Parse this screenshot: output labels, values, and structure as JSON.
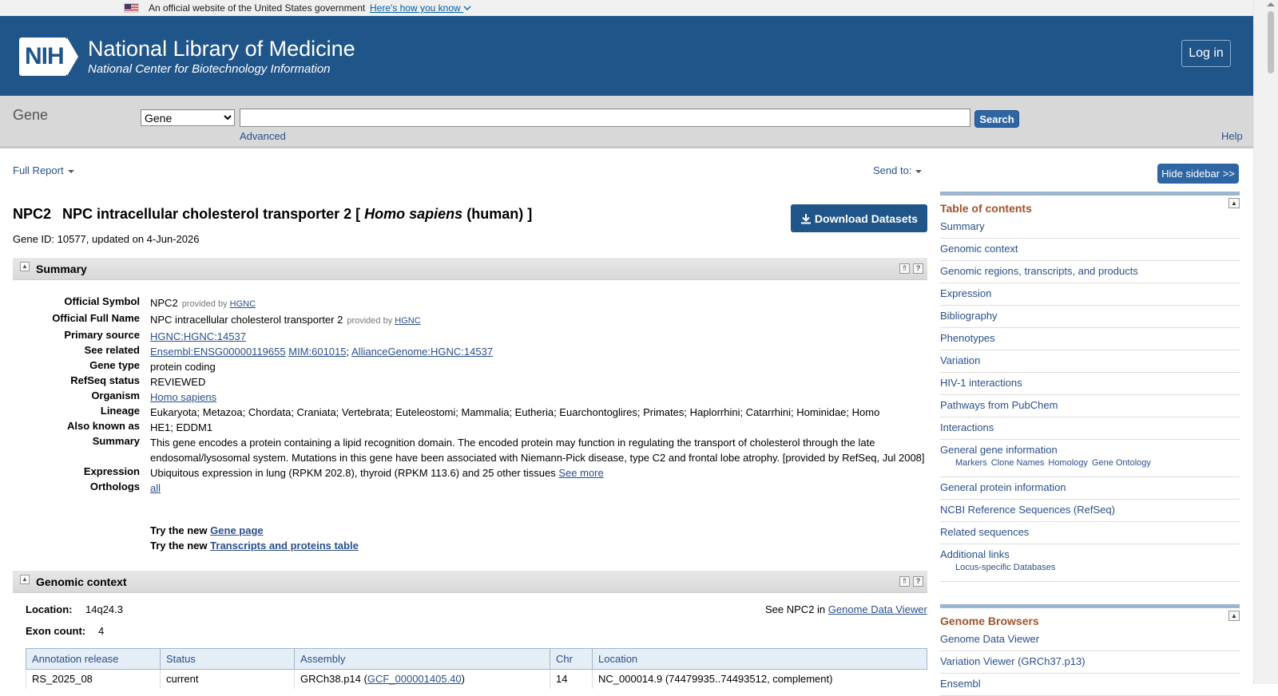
{
  "gov_banner": {
    "text": "An official website of the United States government",
    "how_link": "Here's how you know"
  },
  "header": {
    "logo_text": "NIH",
    "title": "National Library of Medicine",
    "subtitle": "National Center for Biotechnology Information",
    "login_label": "Log in"
  },
  "search": {
    "db_title": "Gene",
    "db_selected": "Gene",
    "value": "",
    "button": "Search",
    "advanced": "Advanced",
    "help": "Help"
  },
  "toolbar": {
    "full_report": "Full Report",
    "send_to": "Send to:",
    "hide_sidebar": "Hide sidebar >>"
  },
  "gene": {
    "symbol": "NPC2",
    "name": "NPC intracellular cholesterol transporter 2",
    "bracket_open": "[",
    "species": "Homo sapiens",
    "common": "(human)",
    "bracket_close": "]",
    "id_line": "Gene ID: 10577, updated on 4-Jun-2026",
    "download": "Download Datasets"
  },
  "summary": {
    "section_title": "Summary",
    "official_symbol": {
      "label": "Official Symbol",
      "value": "NPC2",
      "provided": "provided by",
      "provider": "HGNC"
    },
    "official_full_name": {
      "label": "Official Full Name",
      "value": "NPC intracellular cholesterol transporter 2",
      "provided": "provided by",
      "provider": "HGNC"
    },
    "primary_source": {
      "label": "Primary source",
      "value": "HGNC:HGNC:14537"
    },
    "see_related": {
      "label": "See related",
      "links": [
        "Ensembl:ENSG00000119655",
        "MIM:601015",
        "AllianceGenome:HGNC:14537"
      ]
    },
    "gene_type": {
      "label": "Gene type",
      "value": "protein coding"
    },
    "refseq_status": {
      "label": "RefSeq status",
      "value": "REVIEWED"
    },
    "organism": {
      "label": "Organism",
      "value": "Homo sapiens"
    },
    "lineage": {
      "label": "Lineage",
      "value": "Eukaryota; Metazoa; Chordata; Craniata; Vertebrata; Euteleostomi; Mammalia; Eutheria; Euarchontoglires; Primates; Haplorrhini; Catarrhini; Hominidae; Homo"
    },
    "also_known_as": {
      "label": "Also known as",
      "value": "HE1; EDDM1"
    },
    "summary_text": {
      "label": "Summary",
      "value": "This gene encodes a protein containing a lipid recognition domain. The encoded protein may function in regulating the transport of cholesterol through the late endosomal/lysosomal system. Mutations in this gene have been associated with Niemann-Pick disease, type C2 and frontal lobe atrophy. [provided by RefSeq, Jul 2008]"
    },
    "expression": {
      "label": "Expression",
      "value": "Ubiquitous expression in lung (RPKM 202.8), thyroid (RPKM 113.6) and 25 other tissues",
      "link": "See more"
    },
    "orthologs": {
      "label": "Orthologs",
      "value": "all"
    },
    "try_new_1": {
      "prefix": "Try the new",
      "link": "Gene page"
    },
    "try_new_2": {
      "prefix": "Try the new",
      "link": "Transcripts and proteins table"
    }
  },
  "genomic_context": {
    "section_title": "Genomic context",
    "location_label": "Location:",
    "location_value": "14q24.3",
    "exon_label": "Exon count:",
    "exon_value": "4",
    "see_in": "See NPC2 in",
    "gdv_link": "Genome Data Viewer",
    "table": {
      "headers": [
        "Annotation release",
        "Status",
        "Assembly",
        "Chr",
        "Location"
      ],
      "row": {
        "release": "RS_2025_08",
        "status": "current",
        "assembly": "GRCh38.p14 (",
        "assembly_link": "GCF_000001405.40",
        "assembly_close": ")",
        "chr": "14",
        "location": "NC_000014.9 (74479935..74493512, complement)"
      }
    }
  },
  "sidebar": {
    "toc_title": "Table of contents",
    "toc": [
      "Summary",
      "Genomic context",
      "Genomic regions, transcripts, and products",
      "Expression",
      "Bibliography",
      "Phenotypes",
      "Variation",
      "HIV-1 interactions",
      "Pathways from PubChem",
      "Interactions",
      "General gene information",
      "General protein information",
      "NCBI Reference Sequences (RefSeq)",
      "Related sequences",
      "Additional links"
    ],
    "general_sub": [
      "Markers",
      "Clone Names",
      "Homology",
      "Gene Ontology"
    ],
    "additional_sub": "Locus-specific Databases",
    "browsers_title": "Genome Browsers",
    "browsers": [
      "Genome Data Viewer",
      "Variation Viewer (GRCh37.p13)",
      "Ensembl"
    ]
  },
  "colors": {
    "header_bg": "#20558a",
    "link": "#2a4f8c",
    "sidebar_heading": "#a0522d",
    "button": "#2e65a3"
  },
  "icons": [
    "us-flag-icon",
    "chevron-down-icon",
    "nih-logo",
    "download-icon",
    "collapse-icon",
    "scroll-top-icon",
    "help-icon"
  ]
}
